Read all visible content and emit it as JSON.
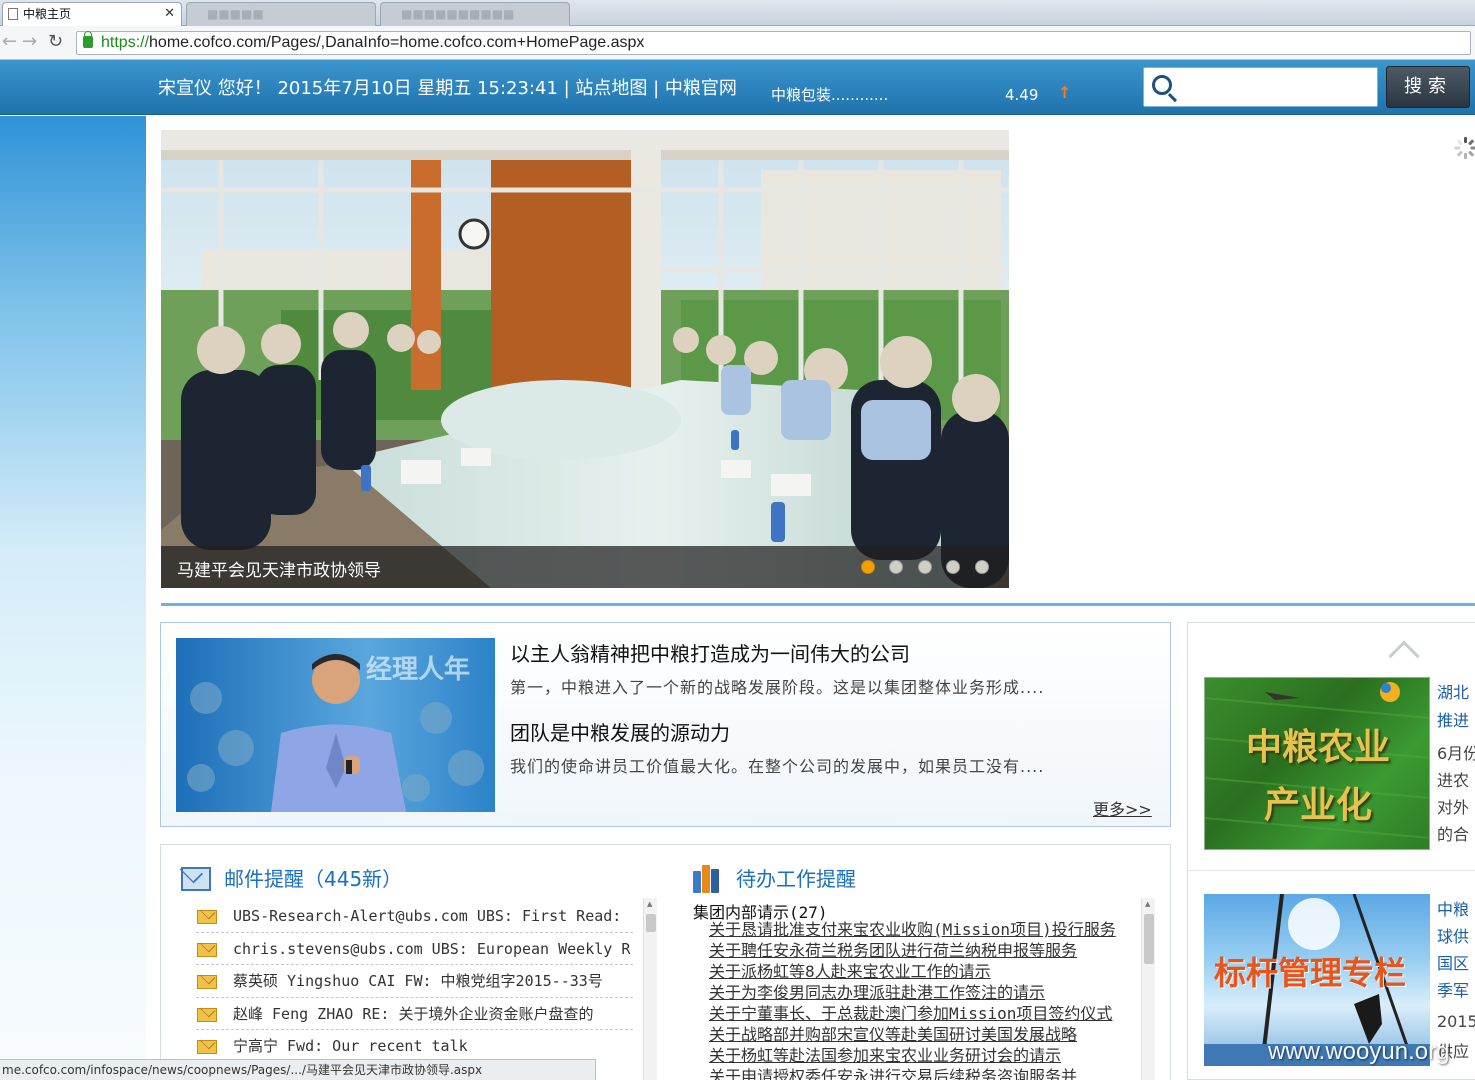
{
  "browser": {
    "active_tab_label": "中粮主页",
    "inactive_tab_1": "■■■■■",
    "inactive_tab_2": "■■■■■■■■■■",
    "url_scheme": "https://",
    "url_rest": "home.cofco.com/Pages/,DanaInfo=home.cofco.com+HomePage.aspx",
    "status_url": "me.cofco.com/infospace/news/coopnews/Pages/.../马建平会见天津市政协领导.aspx"
  },
  "header": {
    "greeting": "宋宣仪  您好！ 2015年7月10日 星期五 15:23:41 | 站点地图 | 中粮官网",
    "ticker_name": "中粮包装............",
    "ticker_value": "4.49",
    "ticker_arrow": "↑",
    "search_placeholder": "",
    "search_button": "搜索"
  },
  "slider": {
    "caption": "马建平会见天津市政协领导",
    "slide_count": 5,
    "active_slide": 1
  },
  "feature": {
    "photo_banner": "经理人年",
    "items": [
      {
        "title": "以主人翁精神把中粮打造成为一间伟大的公司",
        "desc": "第一，中粮进入了一个新的战略发展阶段。这是以集团整体业务形成...."
      },
      {
        "title": "团队是中粮发展的源动力",
        "desc": "我们的使命讲员工价值最大化。在整个公司的发展中，如果员工没有...."
      }
    ],
    "more": "更多>>"
  },
  "right": {
    "agri_line1": "中粮农业",
    "agri_line2": "产业化",
    "agri_side": [
      "湖北",
      "推进",
      "6月份",
      "进农",
      "对外",
      "的合"
    ],
    "bench_title": "标杆管理专栏",
    "bench_side": [
      "中粮",
      "球供",
      "国区",
      "季军",
      "2015",
      "供应"
    ]
  },
  "mail": {
    "title": "邮件提醒（445新）",
    "items": [
      "UBS-Research-Alert@ubs.com  UBS: First Read: ",
      "chris.stevens@ubs.com  UBS: European Weekly R",
      "蔡英硕 Yingshuo CAI  FW: 中粮党组字2015--33号",
      "赵峰 Feng ZHAO  RE: 关于境外企业资金账户盘查的",
      "宁高宁  Fwd: Our recent talk"
    ]
  },
  "todo": {
    "title": "待办工作提醒",
    "group": "集团内部请示(27)",
    "items": [
      "关于恳请批准支付来宝农业收购(Mission项目)投行服务",
      "关于聘任安永荷兰税务团队进行荷兰纳税申报等服务",
      "关于派杨虹等8人赴来宝农业工作的请示",
      "关于为李俊男同志办理派驻赴港工作签注的请示",
      "关于宁董事长、于总裁赴澳门参加Mission项目签约仪式",
      "关于战略部并购部宋宣仪等赴美国研讨美国发展战略",
      "关于杨虹等赴法国参加来宝农业业务研讨会的请示",
      "关于申请授权委任安永进行交易后续税务咨询服务并"
    ]
  },
  "watermark": "www.wooyun.org",
  "colors": {
    "header_blue": "#2a84c0",
    "title_blue": "#1a6fbf",
    "active_dot": "#f5a000",
    "ticker_up": "#ff7a1a"
  }
}
